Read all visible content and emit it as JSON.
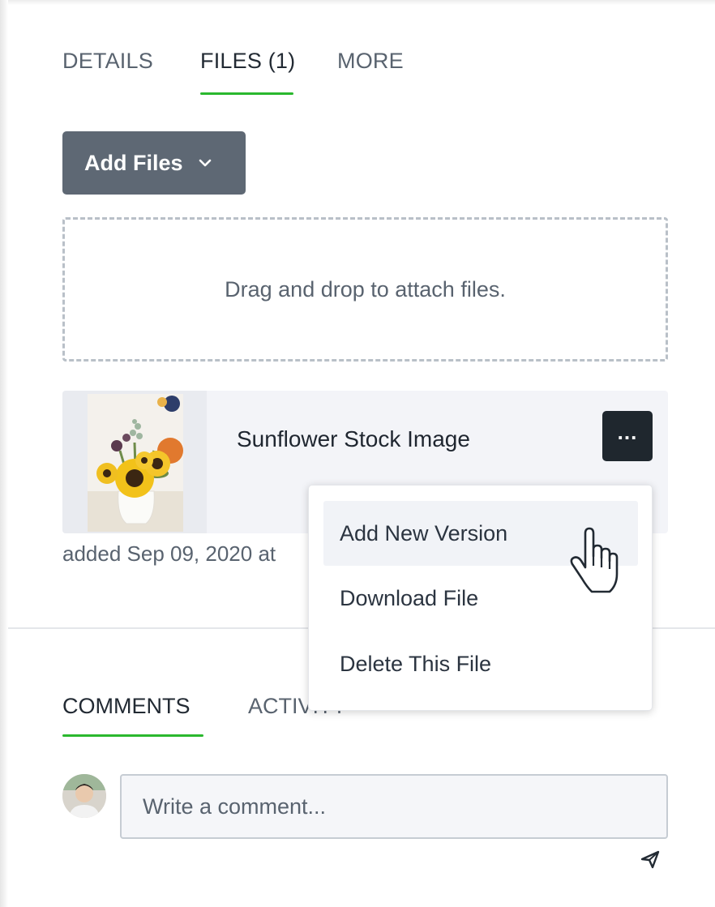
{
  "tabs": [
    {
      "label": "DETAILS",
      "active": false
    },
    {
      "label": "FILES (1)",
      "active": true
    },
    {
      "label": "MORE",
      "active": false
    }
  ],
  "add_files": {
    "label": "Add Files",
    "icon": "chevron-down-icon"
  },
  "dropzone": {
    "text": "Drag and drop to attach files."
  },
  "file": {
    "name": "Sunflower Stock Image",
    "added_text": "added Sep 09, 2020 at",
    "more_icon": "ellipsis-icon"
  },
  "menu": {
    "items": [
      {
        "label": "Add New Version",
        "hovered": true
      },
      {
        "label": "Download File",
        "hovered": false
      },
      {
        "label": "Delete This File",
        "hovered": false
      }
    ]
  },
  "comments": {
    "tabs": [
      {
        "label": "COMMENTS",
        "active": true
      },
      {
        "label": "ACTIVITY",
        "active": false
      }
    ],
    "input_placeholder": "Write a comment...",
    "send_icon": "send-icon"
  },
  "colors": {
    "accent": "#2ab82e",
    "button_bg": "#5e6874",
    "dark_button": "#1f272e"
  }
}
